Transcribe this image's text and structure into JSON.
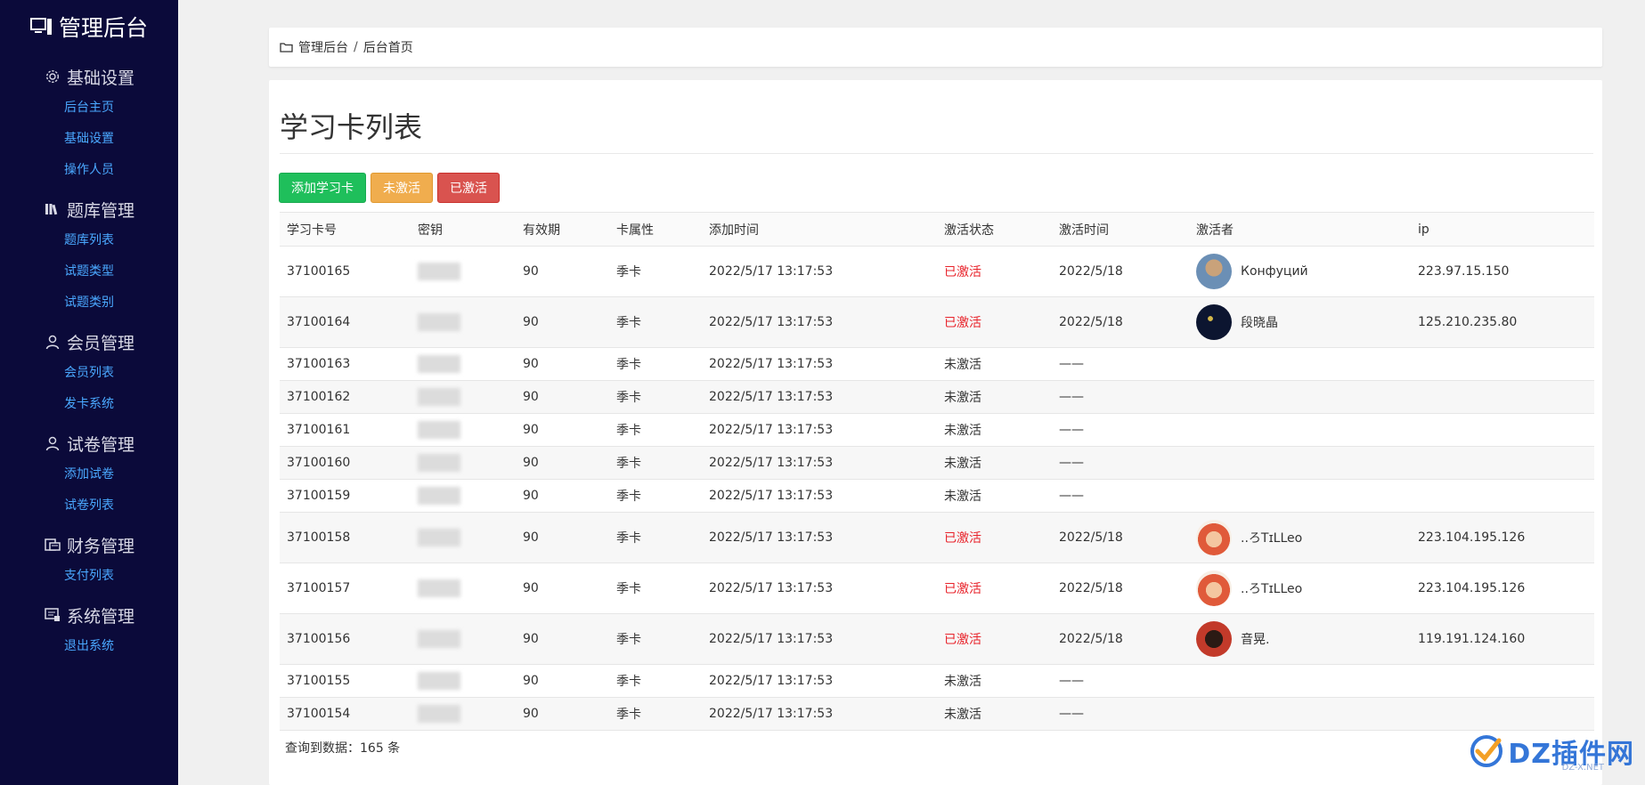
{
  "sidebar": {
    "brand": "管理后台",
    "groups": [
      {
        "icon": "gear-icon",
        "label": "基础设置",
        "items": [
          "后台主页",
          "基础设置",
          "操作人员"
        ]
      },
      {
        "icon": "books-icon",
        "label": "题库管理",
        "items": [
          "题库列表",
          "试题类型",
          "试题类别"
        ]
      },
      {
        "icon": "user-icon",
        "label": "会员管理",
        "items": [
          "会员列表",
          "发卡系统"
        ]
      },
      {
        "icon": "user-icon",
        "label": "试卷管理",
        "items": [
          "添加试卷",
          "试卷列表"
        ]
      },
      {
        "icon": "finance-icon",
        "label": "财务管理",
        "items": [
          "支付列表"
        ]
      },
      {
        "icon": "system-icon",
        "label": "系统管理",
        "items": [
          "退出系统"
        ]
      }
    ]
  },
  "breadcrumb": {
    "root": "管理后台",
    "separator": "/",
    "current": "后台首页"
  },
  "page": {
    "title": "学习卡列表",
    "buttons": {
      "add": "添加学习卡",
      "inactive": "未激活",
      "active": "已激活"
    }
  },
  "table": {
    "columns": [
      "学习卡号",
      "密钥",
      "有效期",
      "卡属性",
      "添加时间",
      "激活状态",
      "激活时间",
      "激活者",
      "ip"
    ],
    "rows": [
      {
        "id": "37100165",
        "key": "",
        "validity": "90",
        "type": "季卡",
        "added": "2022/5/17 13:17:53",
        "status": "已激活",
        "activated": "2022/5/18",
        "user": "Конфуций",
        "ip": "223.97.15.150"
      },
      {
        "id": "37100164",
        "key": "",
        "validity": "90",
        "type": "季卡",
        "added": "2022/5/17 13:17:53",
        "status": "已激活",
        "activated": "2022/5/18",
        "user": "段晓晶",
        "ip": "125.210.235.80"
      },
      {
        "id": "37100163",
        "key": "",
        "validity": "90",
        "type": "季卡",
        "added": "2022/5/17 13:17:53",
        "status": "未激活",
        "activated": "——",
        "user": "",
        "ip": ""
      },
      {
        "id": "37100162",
        "key": "",
        "validity": "90",
        "type": "季卡",
        "added": "2022/5/17 13:17:53",
        "status": "未激活",
        "activated": "——",
        "user": "",
        "ip": ""
      },
      {
        "id": "37100161",
        "key": "",
        "validity": "90",
        "type": "季卡",
        "added": "2022/5/17 13:17:53",
        "status": "未激活",
        "activated": "——",
        "user": "",
        "ip": ""
      },
      {
        "id": "37100160",
        "key": "",
        "validity": "90",
        "type": "季卡",
        "added": "2022/5/17 13:17:53",
        "status": "未激活",
        "activated": "——",
        "user": "",
        "ip": ""
      },
      {
        "id": "37100159",
        "key": "",
        "validity": "90",
        "type": "季卡",
        "added": "2022/5/17 13:17:53",
        "status": "未激活",
        "activated": "——",
        "user": "",
        "ip": ""
      },
      {
        "id": "37100158",
        "key": "",
        "validity": "90",
        "type": "季卡",
        "added": "2022/5/17 13:17:53",
        "status": "已激活",
        "activated": "2022/5/18",
        "user": "..ろTɪLLeo",
        "ip": "223.104.195.126"
      },
      {
        "id": "37100157",
        "key": "",
        "validity": "90",
        "type": "季卡",
        "added": "2022/5/17 13:17:53",
        "status": "已激活",
        "activated": "2022/5/18",
        "user": "..ろTɪLLeo",
        "ip": "223.104.195.126"
      },
      {
        "id": "37100156",
        "key": "",
        "validity": "90",
        "type": "季卡",
        "added": "2022/5/17 13:17:53",
        "status": "已激活",
        "activated": "2022/5/18",
        "user": "音晃.",
        "ip": "119.191.124.160"
      },
      {
        "id": "37100155",
        "key": "",
        "validity": "90",
        "type": "季卡",
        "added": "2022/5/17 13:17:53",
        "status": "未激活",
        "activated": "——",
        "user": "",
        "ip": ""
      },
      {
        "id": "37100154",
        "key": "",
        "validity": "90",
        "type": "季卡",
        "added": "2022/5/17 13:17:53",
        "status": "未激活",
        "activated": "——",
        "user": "",
        "ip": ""
      }
    ],
    "footer": "查询到数据：165 条"
  },
  "colors": {
    "sidebar_bg": "#0b0a3a",
    "nav_link": "#4aa8ff",
    "active_status": "#e8232b",
    "btn_green": "#1fbf5b",
    "btn_orange": "#f0ad4e",
    "btn_red": "#d9534f"
  },
  "watermark": {
    "text": "DZ插件网",
    "sub": "DZ-X.NET"
  }
}
